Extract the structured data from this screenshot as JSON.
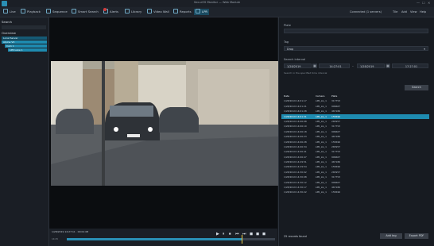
{
  "window": {
    "title": "SecurOS Monitor — Web Module",
    "controls": [
      "—",
      "☐",
      "✕"
    ]
  },
  "menu": {
    "tabs": [
      {
        "label": "Live",
        "icon": "camera-icon"
      },
      {
        "label": "Playback",
        "icon": "playback-icon"
      },
      {
        "label": "Sequence",
        "icon": "sequence-icon"
      },
      {
        "label": "Smart Search",
        "icon": "search-icon"
      },
      {
        "label": "Alerts",
        "icon": "alert-icon"
      },
      {
        "label": "Library",
        "icon": "library-icon"
      },
      {
        "label": "Video Wall",
        "icon": "video-wall-icon"
      },
      {
        "label": "Reports",
        "icon": "reports-icon"
      },
      {
        "label": "LPR",
        "icon": "lpr-icon"
      }
    ],
    "right": [
      {
        "label": "Connected (1 servers)"
      },
      {
        "label": "Tile"
      },
      {
        "label": "Add"
      },
      {
        "label": "View"
      },
      {
        "label": "Help"
      }
    ]
  },
  "left_panel": {
    "title": "Search",
    "subtitle": "Overview",
    "tree": [
      "Local Server",
      "Alpine VC",
      "Cam 1",
      "LPR Lane 1"
    ]
  },
  "player": {
    "timestamp": "1/28/2019 14:27:11 · 00:01:08",
    "buttons": [
      "▶",
      "⏸",
      "⏹",
      "⏮",
      "⏭",
      "◼",
      "◼",
      "◼"
    ],
    "timeline_labels": [
      "14:25",
      "14:26"
    ],
    "progress": 0.84
  },
  "right_panel": {
    "plate_label": "Plate",
    "tag_label": "Tag",
    "tag_value": "Drop",
    "interval_label": "Search interval",
    "from_date": "1/28/2019",
    "from_time": "14:27:01",
    "to_date": "1/28/2019",
    "to_time": "17:27:01",
    "separator": "–",
    "hint": "Search in the specified time interval",
    "search_button": "Search",
    "columns": [
      "Date",
      "Camera",
      "Plate"
    ],
    "rows": [
      [
        "1/28/2019 14:01:17",
        "LPR_LG_1",
        "317753"
      ],
      [
        "1/28/2019 14:01:21",
        "LPR_LG_1",
        "906667"
      ],
      [
        "1/28/2019 14:01:28",
        "LPR_LG_1",
        "467186"
      ],
      [
        "1/28/2019 14:01:31",
        "LPR_LG_1",
        "155696"
      ],
      [
        "1/28/2019 14:06:08",
        "LPR_LG_1",
        "265957"
      ],
      [
        "1/28/2019 14:06:10",
        "LPR_LG_1",
        "317753"
      ],
      [
        "1/28/2019 14:06:18",
        "LPR_LG_1",
        "906667"
      ],
      [
        "1/28/2019 14:06:23",
        "LPR_LG_1",
        "467186"
      ],
      [
        "1/28/2019 14:06:28",
        "LPR_LG_1",
        "155696"
      ],
      [
        "1/28/2019 14:06:34",
        "LPR_LG_1",
        "265957"
      ],
      [
        "1/28/2019 14:06:41",
        "LPR_LG_1",
        "317753"
      ],
      [
        "1/28/2019 14:06:47",
        "LPR_LG_1",
        "906667"
      ],
      [
        "1/28/2019 14:29:51",
        "LPR_LG_1",
        "467186"
      ],
      [
        "1/28/2019 14:29:54",
        "LPR_LG_1",
        "155696"
      ],
      [
        "1/28/2019 14:30:02",
        "LPR_LG_1",
        "265957"
      ],
      [
        "1/28/2019 14:30:08",
        "LPR_LG_1",
        "317753"
      ],
      [
        "1/28/2019 14:30:12",
        "LPR_LG_1",
        "906667"
      ],
      [
        "1/28/2019 14:30:17",
        "LPR_LG_1",
        "467186"
      ],
      [
        "1/28/2019 14:30:22",
        "LPR_LG_1",
        "155696"
      ]
    ],
    "selected_index": 3,
    "footer": "25 records found",
    "buttons": [
      "Add tag",
      "Export PDF"
    ]
  }
}
